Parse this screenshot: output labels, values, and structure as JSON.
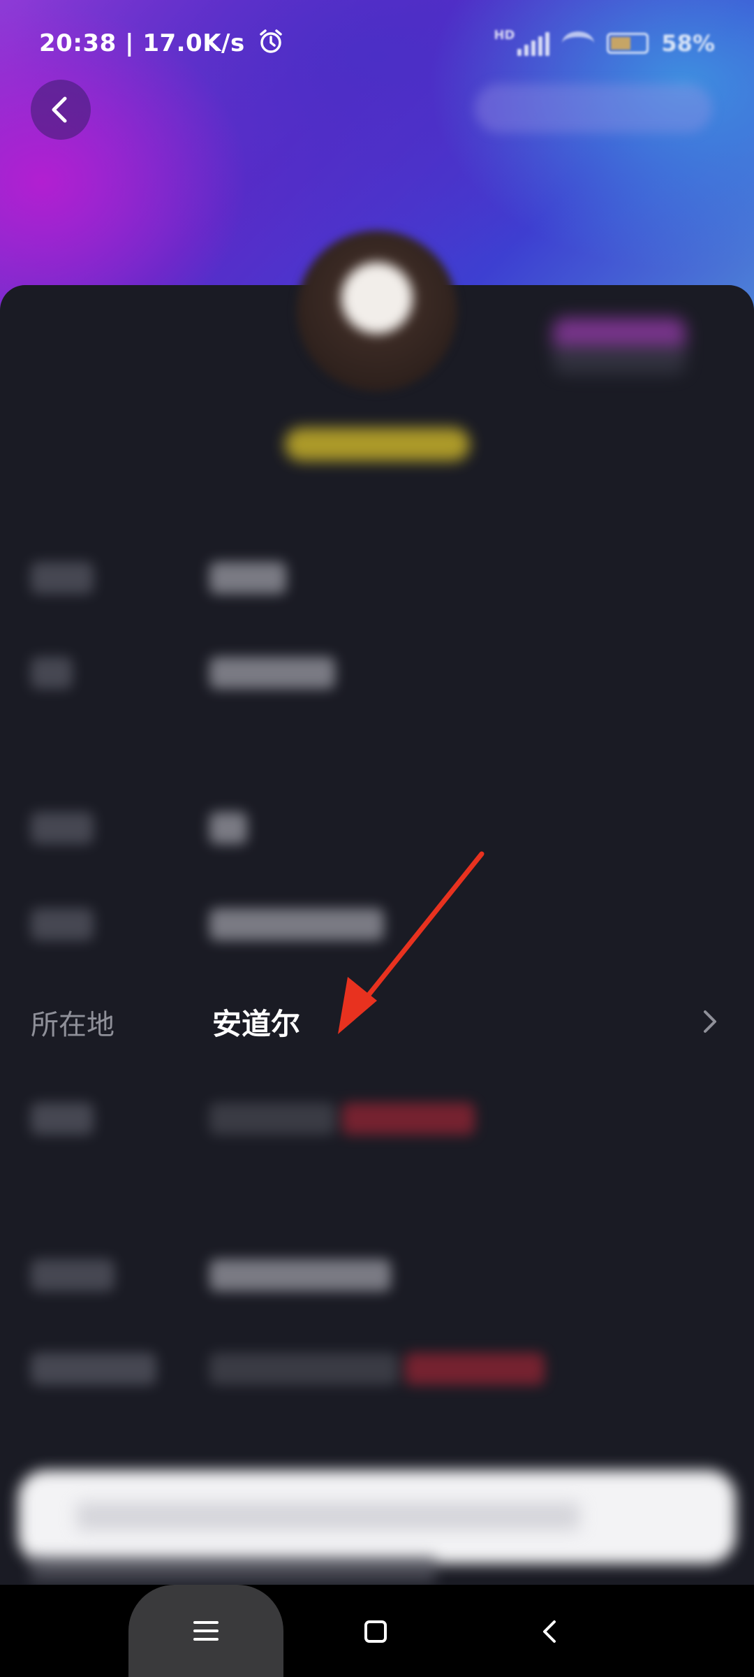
{
  "status_bar": {
    "time": "20:38 | 17.0K/s",
    "alarm_icon": "alarm-clock-icon",
    "network_label": "HD",
    "battery": "58%"
  },
  "header": {
    "back_icon": "chevron-left-icon"
  },
  "rows": [
    {
      "label": "所在地",
      "value": "安道尔"
    }
  ],
  "annotation": {
    "arrow_color": "#e8321f"
  },
  "nav": {
    "menu_icon": "menu-icon",
    "home_icon": "home-square-icon",
    "back_icon": "back-triangle-icon"
  },
  "colors": {
    "background": "#1a1b24",
    "label": "#8f9099",
    "value": "#ffffff",
    "accent_purple": "#8e3ad6",
    "accent_blue": "#4e86d8"
  }
}
